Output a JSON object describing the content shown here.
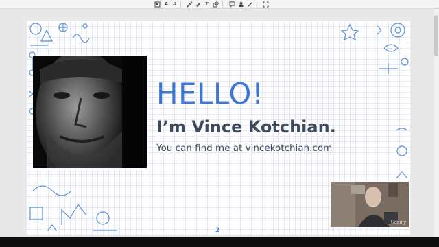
{
  "toolbar": {
    "tools": [
      "select-tool",
      "text-tool",
      "text-style-tool",
      "font-tool",
      "pen-tool",
      "highlighter-tool",
      "text-box-tool",
      "shapes-tool",
      "comment-tool",
      "stamp-tool",
      "signature-tool",
      "fullscreen-tool"
    ],
    "text_tool_glyph": "A",
    "text_style_glyph": "A",
    "text_box_glyph": "T"
  },
  "slide": {
    "heading": "HELLO!",
    "name_line": "I’m Vince Kotchian.",
    "contact_line": "You can find me at vincekotchian.com",
    "page_number": "2"
  },
  "webcam": {
    "watermark": "Udemy"
  },
  "colors": {
    "accent": "#3e77d6",
    "text_dark": "#3d4b5c",
    "doodle": "#5b8fd6",
    "grid": "#e5eaf3"
  }
}
